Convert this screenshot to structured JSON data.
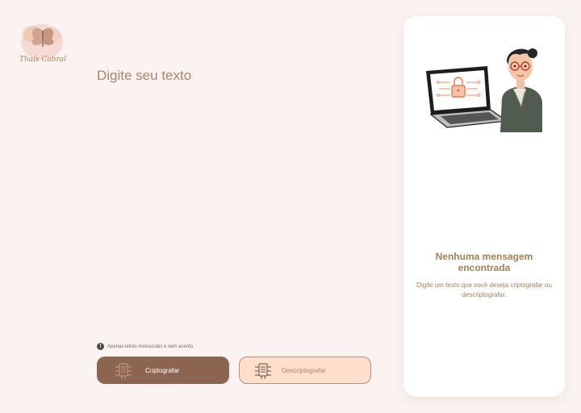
{
  "logo": {
    "alt_text": "Thais Cabral",
    "icon": "butterfly-logo"
  },
  "editor": {
    "placeholder": "Digite seu texto",
    "value": ""
  },
  "hint": {
    "icon": "info-icon",
    "text": "Apenas letras minúsculas e sem acento."
  },
  "actions": {
    "encrypt": {
      "label": "Criptografar",
      "icon": "chip-document-icon"
    },
    "decrypt": {
      "label": "Descriptografar",
      "icon": "chip-document-icon"
    }
  },
  "result_panel": {
    "illustration": "woman-with-laptop-lock-illustration",
    "title": "Nenhuma mensagem encontrada",
    "description": "Digite um texto que você deseja criptografar ou descriptografar."
  },
  "colors": {
    "background": "#fbf3f1",
    "primary": "#8b6550",
    "secondary": "#fddfcc",
    "accent_text": "#a08158"
  }
}
